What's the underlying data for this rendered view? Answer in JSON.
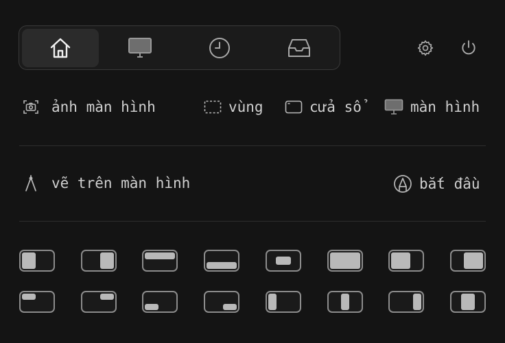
{
  "tabs": [
    {
      "name": "home-icon",
      "active": true
    },
    {
      "name": "monitor-icon",
      "active": false
    },
    {
      "name": "clock-icon",
      "active": false
    },
    {
      "name": "inbox-icon",
      "active": false
    }
  ],
  "toolbar": {
    "settings_icon": "gear-icon",
    "power_icon": "power-icon"
  },
  "screenshot": {
    "label": "ảnh màn hình",
    "region": "vùng",
    "window": "cửa sổ",
    "screen": "màn hình"
  },
  "draw": {
    "label": "vẽ trên màn hình",
    "start": "bắt đầu"
  },
  "layouts": [
    "left-half",
    "right-half",
    "top-half",
    "bottom-half",
    "center",
    "maximize",
    "left-two-thirds",
    "right-two-thirds",
    "top-left-quarter",
    "top-right-quarter",
    "bottom-left-quarter",
    "bottom-right-quarter",
    "first-third",
    "center-third",
    "last-third",
    "center-two-thirds"
  ],
  "colors": {
    "background": "#141414",
    "accent_fill": "#b9b9b9",
    "border": "#8c8c8c"
  }
}
